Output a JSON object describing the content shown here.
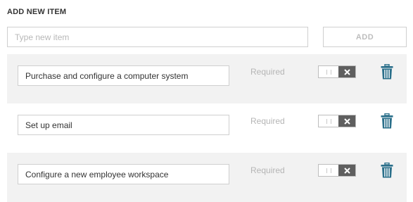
{
  "header": {
    "title": "ADD NEW ITEM"
  },
  "new_item": {
    "placeholder": "Type new item",
    "add_label": "ADD"
  },
  "items": [
    {
      "value": "Purchase and configure a computer system",
      "required_label": "Required",
      "required_on": false
    },
    {
      "value": "Set up email",
      "required_label": "Required",
      "required_on": false
    },
    {
      "value": "Configure a new employee workspace",
      "required_label": "Required",
      "required_on": false
    }
  ],
  "icons": {
    "toggle": "x-icon",
    "delete": "trash-icon"
  },
  "colors": {
    "accent": "#2a6f8a",
    "toggle_dark": "#5f5f5f",
    "row_shade": "#f2f2f2"
  }
}
